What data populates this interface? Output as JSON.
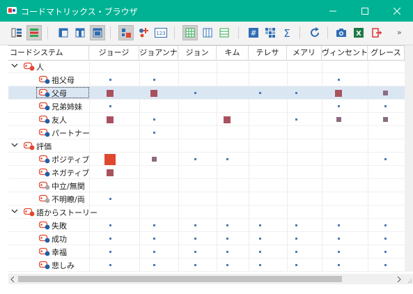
{
  "window": {
    "title": "コードマトリックス・ブラウザ",
    "accent": "#00b294",
    "icons": [
      "app-logo-icon",
      "minimize-icon",
      "maximize-icon",
      "close-icon"
    ]
  },
  "toolbar": {
    "icons": [
      "code-system-icon",
      "row-list-icon",
      "layout-left-icon",
      "layout-center-icon",
      "layout-full-icon",
      "squares-view-icon",
      "symbols-view-icon",
      "numbers-view-icon",
      "grid-table-icon",
      "column-view-icon",
      "row-view-icon",
      "hash-icon",
      "pattern-icon",
      "sigma-icon",
      "refresh-icon",
      "camera-icon",
      "excel-export-icon",
      "exit-icon"
    ],
    "overflow_label": "»"
  },
  "table": {
    "first_header": "コードシステム",
    "columns": [
      "ジョージ",
      "ジョアンナ",
      "ジョン",
      "キム",
      "テレサ",
      "メアリ",
      "ヴィンセント",
      "グレース"
    ],
    "rows": [
      {
        "label": "人",
        "level": 0,
        "expanded": true,
        "icon": "red"
      },
      {
        "label": "祖父母",
        "level": 1,
        "icon": "blue"
      },
      {
        "label": "父母",
        "level": 1,
        "icon": "blue",
        "selected": true
      },
      {
        "label": "兄弟姉妹",
        "level": 1,
        "icon": "blue"
      },
      {
        "label": "友人",
        "level": 1,
        "icon": "blue"
      },
      {
        "label": "パートナー",
        "level": 1,
        "icon": "blue"
      },
      {
        "label": "評価",
        "level": 0,
        "expanded": true,
        "icon": "red"
      },
      {
        "label": "ポジティブ",
        "level": 1,
        "icon": "blue"
      },
      {
        "label": "ネガティブ",
        "level": 1,
        "icon": "blue"
      },
      {
        "label": "中立/無関",
        "level": 1,
        "icon": "gray"
      },
      {
        "label": "不明瞭/両",
        "level": 1,
        "icon": "gray"
      },
      {
        "label": "語からストーリー",
        "level": 0,
        "expanded": true,
        "icon": "red"
      },
      {
        "label": "失敗",
        "level": 1,
        "icon": "blue"
      },
      {
        "label": "成功",
        "level": 1,
        "icon": "blue"
      },
      {
        "label": "幸福",
        "level": 1,
        "icon": "blue"
      },
      {
        "label": "悲しみ",
        "level": 1,
        "icon": "blue"
      }
    ],
    "cells_note_key": "s=small dot, m=medium square, l=large square, x=largest red square",
    "cells": [
      [
        "",
        "",
        "",
        "",
        "",
        "",
        "",
        ""
      ],
      [
        "s",
        "s",
        "",
        "",
        "",
        "",
        "s",
        ""
      ],
      [
        "l",
        "l",
        "s",
        "",
        "s",
        "s",
        "l",
        "m"
      ],
      [
        "s",
        "",
        "",
        "",
        "",
        "",
        "s",
        "s"
      ],
      [
        "l",
        "s",
        "",
        "l",
        "",
        "s",
        "m",
        "m"
      ],
      [
        "",
        "s",
        "",
        "",
        "",
        "",
        "",
        ""
      ],
      [
        "",
        "",
        "",
        "",
        "",
        "",
        "",
        ""
      ],
      [
        "x",
        "m",
        "s",
        "s",
        "",
        "",
        "",
        "s"
      ],
      [
        "l",
        "",
        "",
        "",
        "",
        "",
        "",
        ""
      ],
      [
        "",
        "",
        "",
        "",
        "",
        "",
        "",
        ""
      ],
      [
        "s",
        "",
        "",
        "",
        "",
        "",
        "",
        ""
      ],
      [
        "",
        "",
        "",
        "",
        "",
        "",
        "",
        ""
      ],
      [
        "s",
        "s",
        "s",
        "s",
        "s",
        "s",
        "s",
        "s"
      ],
      [
        "s",
        "s",
        "s",
        "s",
        "s",
        "s",
        "s",
        "s"
      ],
      [
        "s",
        "s",
        "s",
        "s",
        "s",
        "s",
        "s",
        "s"
      ],
      [
        "s",
        "s",
        "s",
        "s",
        "s",
        "s",
        "s",
        "s"
      ]
    ],
    "colors": {
      "small": "#4a7bb7",
      "medium": "#8a6c80",
      "large": "#a8525e",
      "largest": "#e0472f",
      "selection": "#dbe6f3"
    }
  }
}
